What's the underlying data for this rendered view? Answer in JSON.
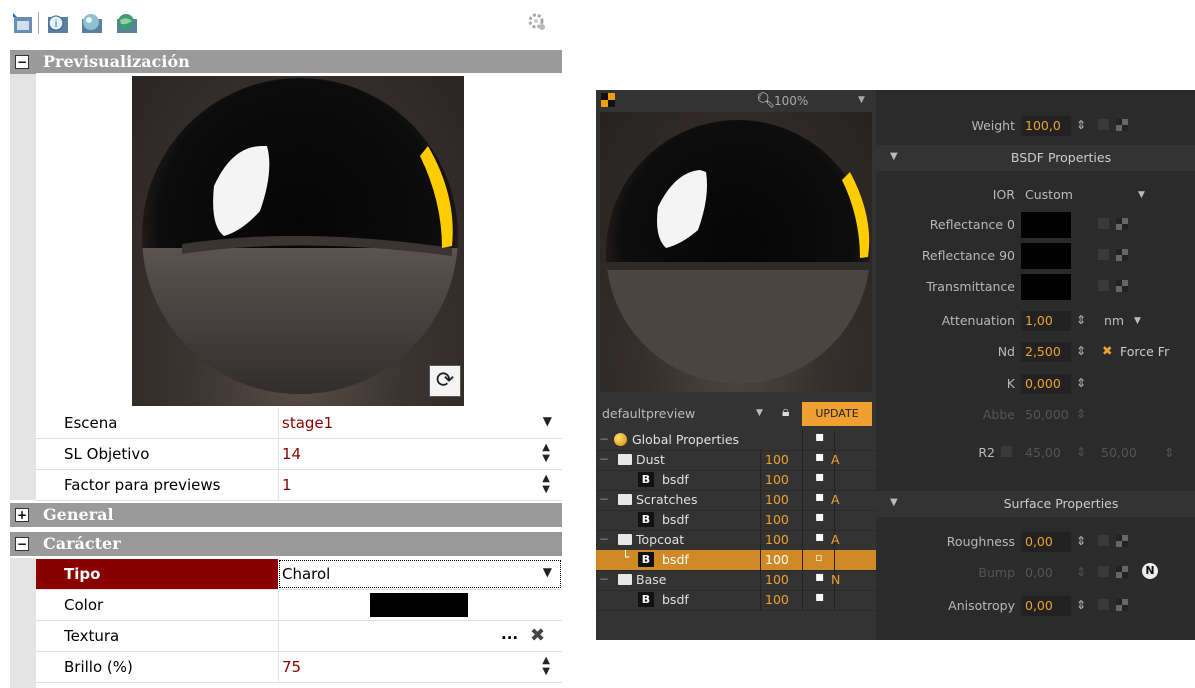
{
  "left_panel": {
    "toolbar_icons": [
      "back-icon",
      "info-icon",
      "render-icon",
      "globe-icon",
      "gear-icon"
    ],
    "preview_section": "Previsualización",
    "rows_preview": [
      {
        "label": "Escena",
        "value": "stage1",
        "control": "dropdown"
      },
      {
        "label": "SL Objetivo",
        "value": "14",
        "control": "spinner"
      },
      {
        "label": "Factor para previews",
        "value": "1",
        "control": "spinner"
      }
    ],
    "general_section": "General",
    "character_section": "Carácter",
    "rows_character": [
      {
        "label": "Tipo",
        "value": "Charol",
        "control": "dropdown"
      },
      {
        "label": "Color",
        "value": "",
        "control": "swatch",
        "color": "#000000"
      },
      {
        "label": "Textura",
        "value": "",
        "control": "browse"
      },
      {
        "label": "Brillo (%)",
        "value": "75",
        "control": "spinner"
      }
    ],
    "browse_label": "..."
  },
  "right_panel": {
    "zoom": "100%",
    "preview_scene": "defaultpreview",
    "update_label": "UPDATE",
    "tree": [
      {
        "name": "Global Properties",
        "weight": "",
        "flag": ""
      },
      {
        "name": "Dust",
        "weight": "100",
        "flag": "A"
      },
      {
        "name": "bsdf",
        "weight": "100",
        "flag": ""
      },
      {
        "name": "Scratches",
        "weight": "100",
        "flag": "A"
      },
      {
        "name": "bsdf",
        "weight": "100",
        "flag": ""
      },
      {
        "name": "Topcoat",
        "weight": "100",
        "flag": "A"
      },
      {
        "name": "bsdf",
        "weight": "100",
        "flag": ""
      },
      {
        "name": "Base",
        "weight": "100",
        "flag": "N"
      },
      {
        "name": "bsdf",
        "weight": "100",
        "flag": ""
      }
    ],
    "props": {
      "weight_label": "Weight",
      "weight_value": "100,0",
      "bsdf_header": "BSDF Properties",
      "ior_label": "IOR",
      "ior_value": "Custom",
      "refl0_label": "Reflectance 0",
      "refl90_label": "Reflectance 90",
      "trans_label": "Transmittance",
      "atten_label": "Attenuation",
      "atten_value": "1,00",
      "atten_unit": "nm",
      "nd_label": "Nd",
      "nd_value": "2,500",
      "force_label": "Force Fr",
      "k_label": "K",
      "k_value": "0,000",
      "abbe_label": "Abbe",
      "abbe_value": "50,000",
      "r2_label": "R2",
      "r2_value1": "45,00",
      "r2_value2": "50,00",
      "surface_header": "Surface Properties",
      "rough_label": "Roughness",
      "rough_value": "0,00",
      "bump_label": "Bump",
      "bump_value": "0,00",
      "aniso_label": "Anisotropy",
      "aniso_value": "0,00"
    }
  },
  "colors": {
    "accent_orange": "#f0a030",
    "selected_row": "#8a0000",
    "section_gray": "#9a9a9a"
  }
}
